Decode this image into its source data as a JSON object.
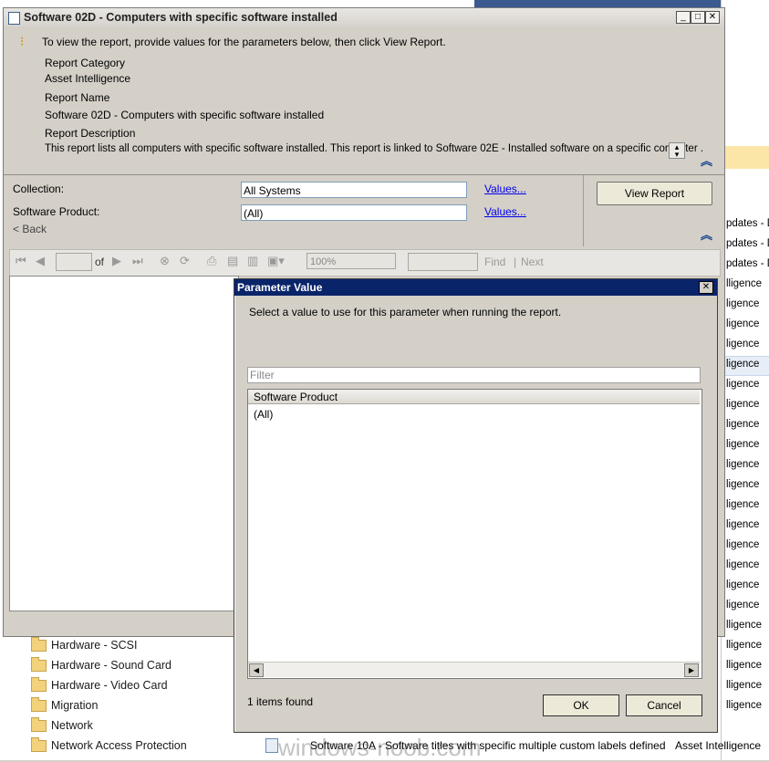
{
  "window": {
    "title": "Software 02D - Computers with specific software installed",
    "info_text": "To view the report, provide values for the parameters below, then click View Report.",
    "report_category_label": "Report Category",
    "report_category_value": "Asset Intelligence",
    "report_name_label": "Report Name",
    "report_name_value": "Software 02D - Computers with specific software installed",
    "report_description_label": "Report Description",
    "report_description_value": "This report lists all computers with specific software installed. This report is linked to Software 02E - Installed software on a specific computer ."
  },
  "params": {
    "collection_label": "Collection:",
    "collection_value": "All Systems",
    "software_label": "Software Product:",
    "software_value": "(All)",
    "values_link": "Values...",
    "back_label": "< Back",
    "view_report": "View Report"
  },
  "toolbar": {
    "of_label": "of",
    "zoom_value": "100%",
    "find_label": "Find",
    "next_label": "Next"
  },
  "dialog": {
    "title": "Parameter Value",
    "instruction": "Select a value to use for this parameter when running the report.",
    "filter_placeholder": "Filter",
    "column_header": "Software Product",
    "items": [
      "(All)"
    ],
    "status": "1 items found",
    "ok_label": "OK",
    "cancel_label": "Cancel"
  },
  "background": {
    "right_rows": [
      "pdates - D",
      "pdates - D",
      "pdates - D",
      "lligence",
      "ligence",
      "ligence",
      "ligence",
      "ligence",
      "ligence",
      "ligence",
      "ligence",
      "ligence",
      "ligence",
      "ligence",
      "ligence",
      "ligence",
      "ligence",
      "ligence",
      "ligence",
      "ligence",
      "lligence",
      "lligence",
      "lligence",
      "lligence",
      "lligence"
    ],
    "tree_items": [
      "Hardware - SCSI",
      "Hardware - Sound Card",
      "Hardware - Video Card",
      "Migration",
      "Network",
      "Network Access Protection"
    ],
    "bottom_row_name": "Software 10A - Software titles with specific multiple custom labels defined",
    "bottom_row_category": "Asset Intelligence",
    "watermark": "windows-noob.com"
  }
}
